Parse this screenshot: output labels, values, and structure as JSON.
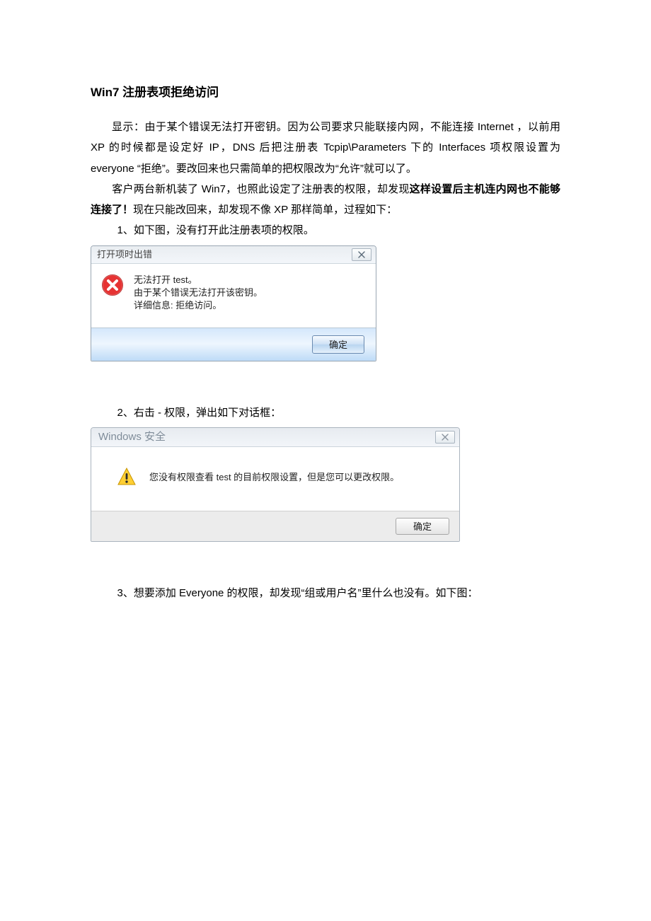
{
  "title": "Win7 注册表项拒绝访问",
  "para1": "显示：由于某个错误无法打开密钥。因为公司要求只能联接内网，不能连接 Internet ，以前用 XP 的时候都是设定好 IP，DNS 后把注册表 Tcpip\\Parameters 下的  Interfaces  项权限设置为  everyone   “拒绝”。要改回来也只需简单的把权限改为“允许”就可以了。",
  "para2_lead": "客户两台新机装了 Win7，也照此设定了注册表的权限，却发现",
  "para2_bold": "这样设置后主机连内网也不能够连接了！",
  "para2_tail": "现在只能改回来，却发现不像 XP 那样简单，过程如下：",
  "step1": "1、如下图，没有打开此注册表项的权限。",
  "dialog1": {
    "title": "打开项时出错",
    "line1": "无法打开 test。",
    "line2": "由于某个错误无法打开该密钥。",
    "line3": "详细信息: 拒绝访问。",
    "ok": "确定"
  },
  "step2": "2、右击 - 权限，弹出如下对话框：",
  "dialog2": {
    "title": "Windows 安全",
    "msg": "您没有权限查看 test 的目前权限设置，但是您可以更改权限。",
    "ok": "确定"
  },
  "step3": "3、想要添加 Everyone 的权限，却发现“组或用户名”里什么也没有。如下图："
}
